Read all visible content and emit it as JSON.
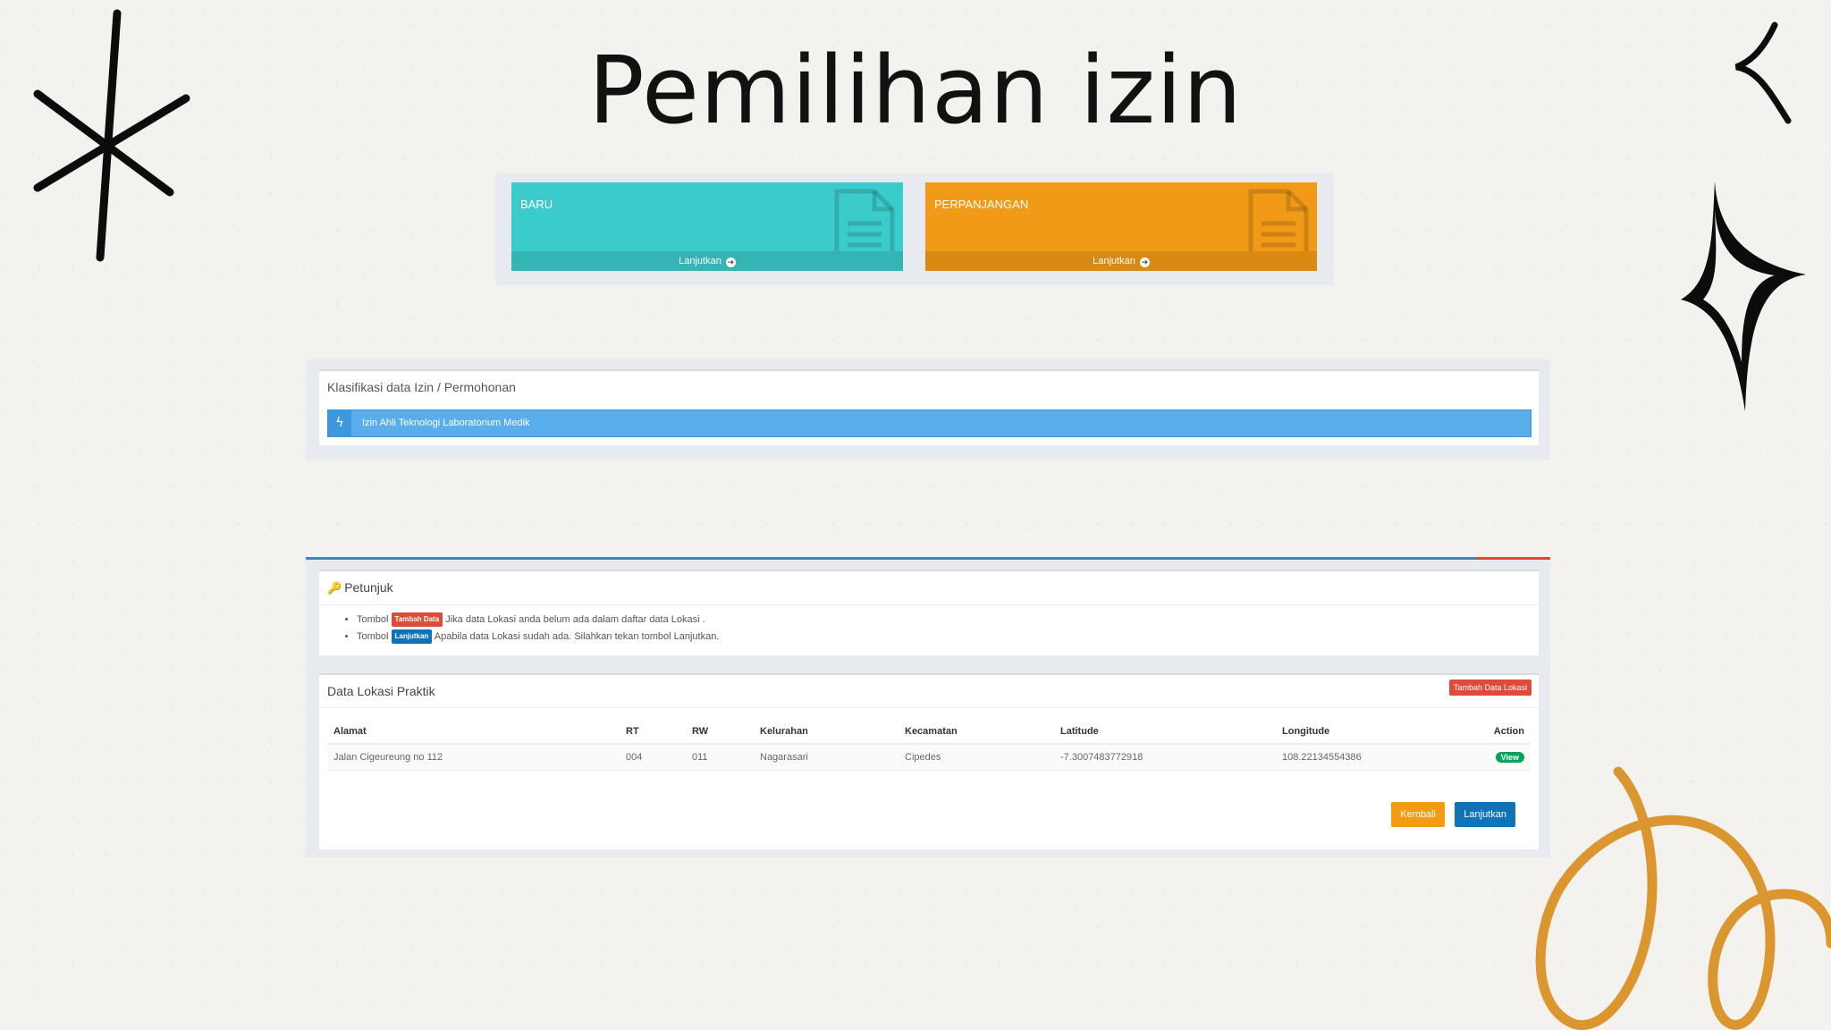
{
  "slide": {
    "title": "Pemilihan izin"
  },
  "cards": [
    {
      "label": "BARU",
      "footer": "Lanjutkan",
      "color": "#3ccbcb"
    },
    {
      "label": "PERPANJANGAN",
      "footer": "Lanjutkan",
      "color": "#f19a17"
    }
  ],
  "klasifikasi": {
    "title": "Klasifikasi data Izin / Permohonan",
    "item": "Izin Ahli Teknologi Laboratorium Medik"
  },
  "petunjuk": {
    "title": "Petunjuk",
    "line1_prefix": "Tombol",
    "line1_badge": "Tambah Data",
    "line1_text": "Jika data Lokasi anda belum ada dalam daftar data Lokasi .",
    "line2_prefix": "Tombol",
    "line2_badge": "Lanjutkan",
    "line2_text": "Apabila data Lokasi sudah ada. Silahkan tekan tombol Lanjutkan."
  },
  "data_lokasi": {
    "title": "Data Lokasi Praktik",
    "add_button": "Tambah Data Lokasi",
    "columns": [
      "Alamat",
      "RT",
      "RW",
      "Kelurahan",
      "Kecamatan",
      "Latitude",
      "Longitude",
      "Action"
    ],
    "rows": [
      {
        "alamat": "Jalan Cigeureung no 112",
        "rt": "004",
        "rw": "011",
        "kelurahan": "Nagarasari",
        "kecamatan": "Cipedes",
        "latitude": "-7.3007483772918",
        "longitude": "108.22134554386",
        "action": "View"
      }
    ],
    "back_button": "Kembali",
    "next_button": "Lanjutkan"
  },
  "colors": {
    "accent_blue": "#0e73b8",
    "accent_red": "#dd4b39",
    "accent_orange": "#f39c12",
    "deco_orange": "#dc962f"
  }
}
